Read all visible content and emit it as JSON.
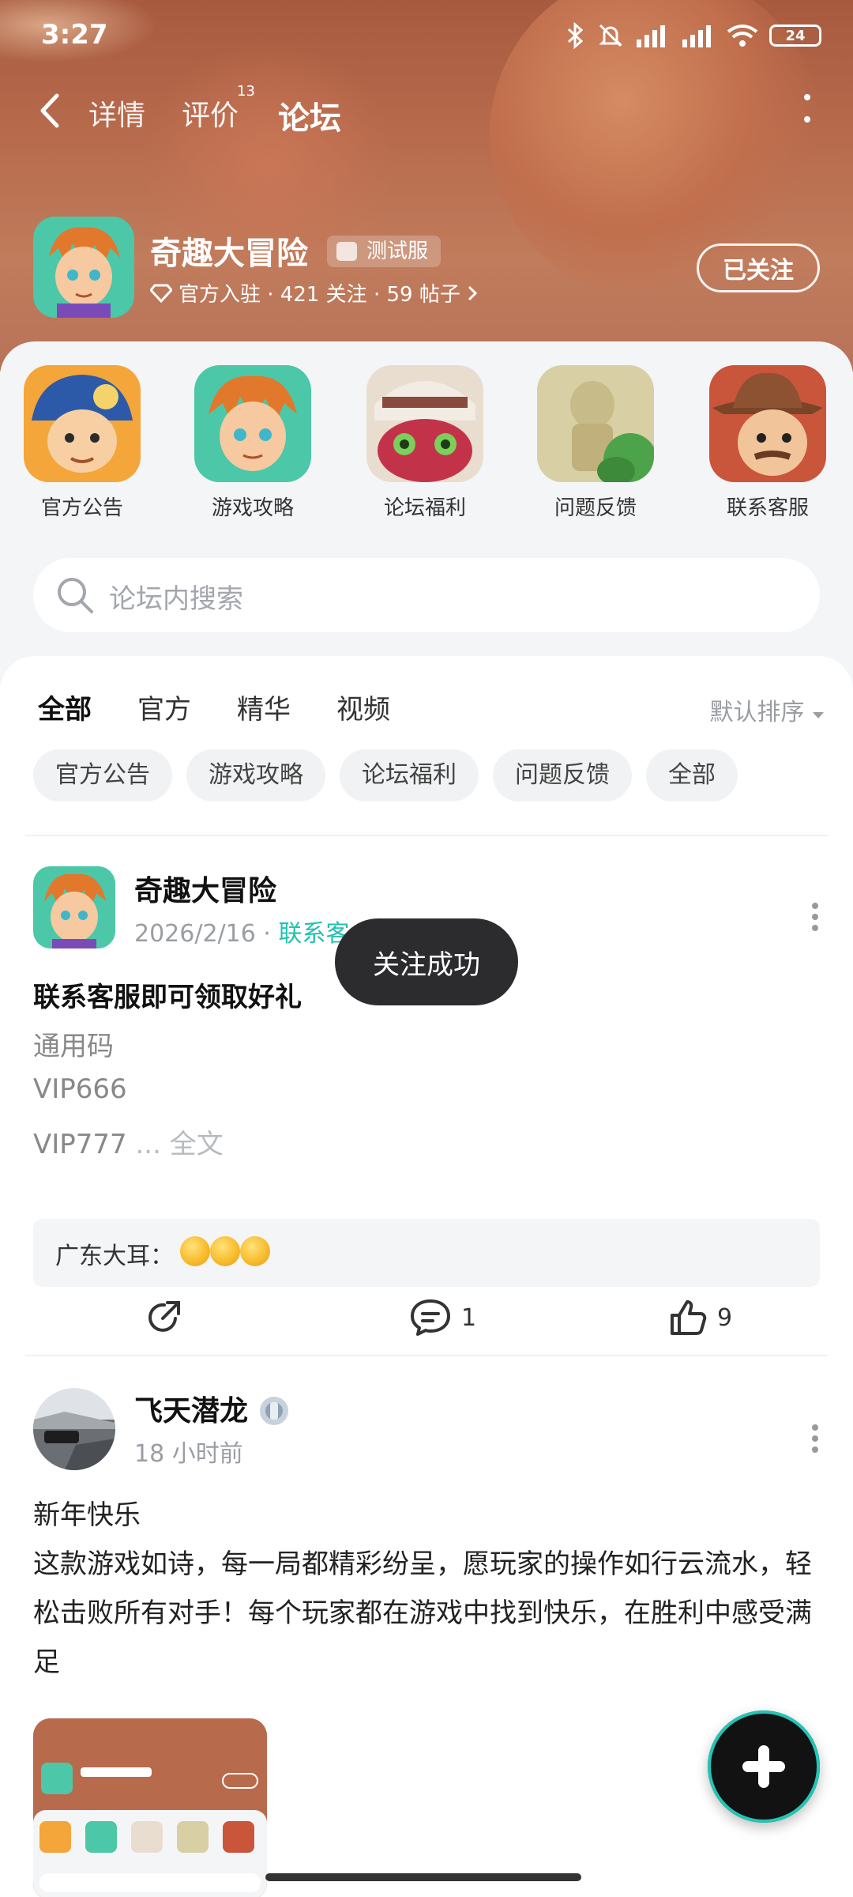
{
  "status_bar": {
    "time": "3:27",
    "battery": "24"
  },
  "nav": {
    "tabs": [
      {
        "label": "详情"
      },
      {
        "label": "评价",
        "badge": "13"
      },
      {
        "label": "论坛"
      }
    ]
  },
  "game": {
    "title": "奇趣大冒险",
    "badge": "测试服",
    "meta": "官方入驻 · 421 关注 · 59 帖子",
    "follow_label": "已关注"
  },
  "quick_entries": [
    {
      "label": "官方公告",
      "icon": "pirate-avatar-icon"
    },
    {
      "label": "游戏攻略",
      "icon": "hero-avatar-icon"
    },
    {
      "label": "论坛福利",
      "icon": "skull-avatar-icon"
    },
    {
      "label": "问题反馈",
      "icon": "statue-avatar-icon"
    },
    {
      "label": "联系客服",
      "icon": "cowboy-avatar-icon"
    }
  ],
  "search": {
    "placeholder": "论坛内搜索"
  },
  "filter_tabs": [
    "全部",
    "官方",
    "精华",
    "视频"
  ],
  "sort_label": "默认排序",
  "chips": [
    "官方公告",
    "游戏攻略",
    "论坛福利",
    "问题反馈",
    "全部"
  ],
  "posts": [
    {
      "author": "奇趣大冒险",
      "date": "2026/2/16",
      "tag": "联系客",
      "title": "联系客服即可领取好礼",
      "lines": [
        "通用码",
        "VIP666",
        "VIP777"
      ],
      "more": "... 全文",
      "comment_author": "广东大耳：",
      "share_count": "",
      "comment_count": "1",
      "like_count": "9"
    },
    {
      "author": "飞天潜龙",
      "time": "18 小时前",
      "body": "新年快乐\n这款游戏如诗，每一局都精彩纷呈，愿玩家的操作如行云流水，轻松击败所有对手！每个玩家都在游戏中找到快乐，在胜利中感受满足"
    }
  ],
  "toast": "关注成功",
  "colors": {
    "accent": "#3fe0c8",
    "header": "#b76a4c",
    "tag": "#22c1b0"
  }
}
